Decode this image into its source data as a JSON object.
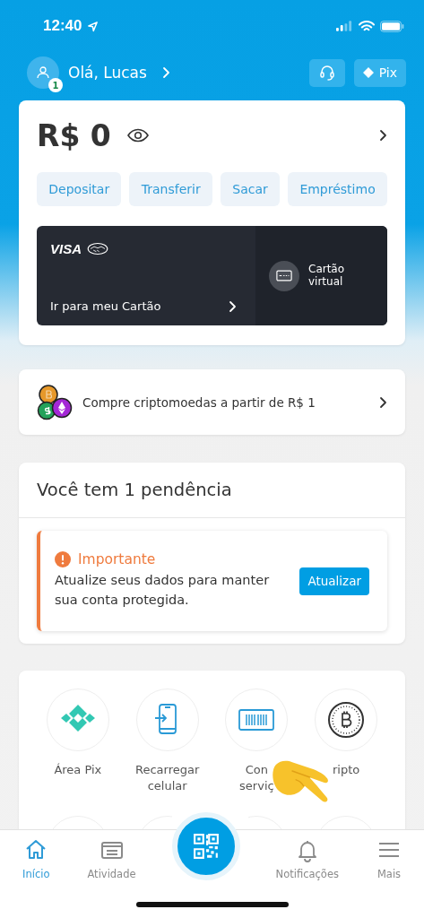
{
  "status_bar": {
    "time": "12:40"
  },
  "header": {
    "greeting": "Olá, Lucas",
    "badge": "1",
    "pix_button": "Pix"
  },
  "balance_card": {
    "balance": "R$ 0",
    "actions": [
      {
        "label": "Depositar"
      },
      {
        "label": "Transferir"
      },
      {
        "label": "Sacar"
      },
      {
        "label": "Empréstimo"
      }
    ],
    "card": {
      "brand": "VISA",
      "link": "Ir para meu Cartão",
      "virtual": "Cartão virtual"
    }
  },
  "promo": {
    "text": "Compre criptomoedas a partir de R$ 1"
  },
  "pending": {
    "title": "Você tem 1 pendência",
    "alert": {
      "title": "Importante",
      "message": "Atualize seus dados para manter sua conta protegida.",
      "button": "Atualizar"
    }
  },
  "shortcuts": [
    {
      "kind": "pix",
      "lines": [
        "Área Pix"
      ]
    },
    {
      "kind": "phone",
      "lines": [
        "Recarregar",
        "celular"
      ]
    },
    {
      "kind": "barcode",
      "lines": [
        "Con",
        "serviç"
      ]
    },
    {
      "kind": "bitcoin",
      "lines": [
        "ripto"
      ]
    }
  ],
  "nav": [
    {
      "kind": "home",
      "label": "Início",
      "selected": true
    },
    {
      "kind": "activity",
      "label": "Atividade",
      "selected": false
    },
    {
      "kind": "qr",
      "selected": false
    },
    {
      "kind": "bell",
      "label": "Notificações",
      "selected": false
    },
    {
      "kind": "menu",
      "label": "Mais",
      "selected": false
    }
  ]
}
